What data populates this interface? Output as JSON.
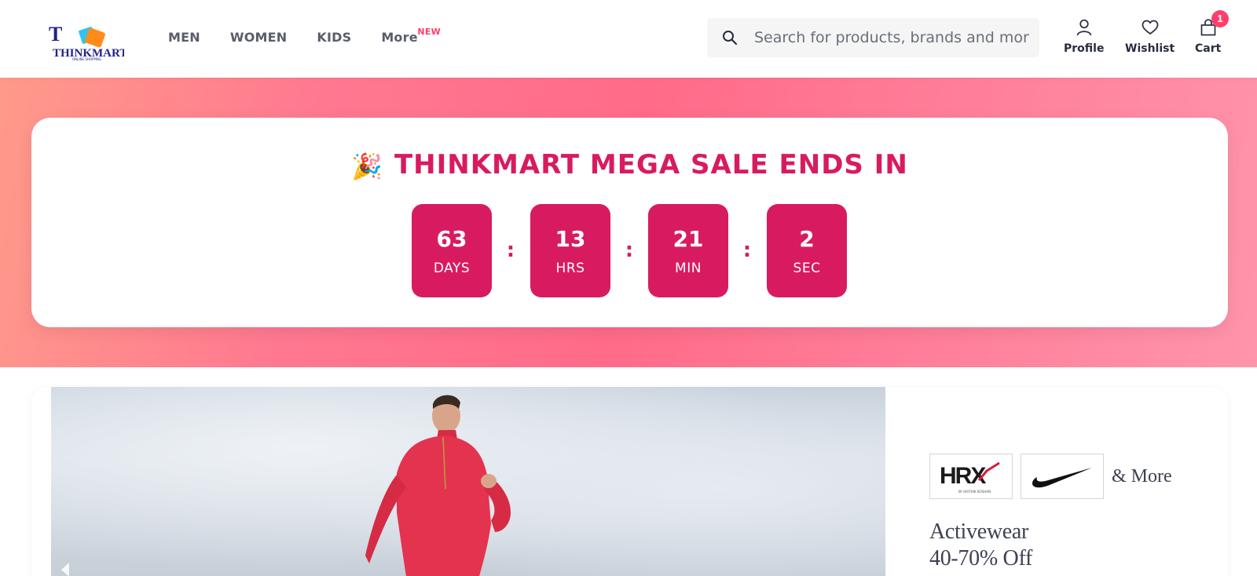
{
  "header": {
    "logo_text": "THINKMART",
    "logo_tagline": "ONLINE SHOPPING",
    "nav": [
      {
        "label": "MEN"
      },
      {
        "label": "WOMEN"
      },
      {
        "label": "KIDS"
      },
      {
        "label": "More",
        "badge": "NEW"
      }
    ],
    "search": {
      "placeholder": "Search for products, brands and more",
      "icon": "search-icon"
    },
    "actions": [
      {
        "label": "Profile",
        "icon": "user-icon"
      },
      {
        "label": "Wishlist",
        "icon": "heart-icon"
      },
      {
        "label": "Cart",
        "icon": "bag-icon",
        "count": "1"
      }
    ]
  },
  "sale": {
    "emoji": "🎉",
    "title": "THINKMART MEGA SALE ENDS IN",
    "timer": [
      {
        "value": "63",
        "unit": "DAYS"
      },
      {
        "value": "13",
        "unit": "HRS"
      },
      {
        "value": "21",
        "unit": "MIN"
      },
      {
        "value": "2",
        "unit": "SEC"
      }
    ],
    "separator": ":"
  },
  "promo": {
    "brands": [
      {
        "name": "HRX",
        "sub": "BY HRITHIK ROSHAN"
      },
      {
        "name": "Nike"
      }
    ],
    "more_label": "& More",
    "line1": "Activewear",
    "line2": "40-70% Off"
  },
  "colors": {
    "accent": "#d81b60",
    "badge": "#ff3f6c",
    "banner_gradient": [
      "#ff9a8a",
      "#ff6b89",
      "#ff94ab"
    ]
  }
}
